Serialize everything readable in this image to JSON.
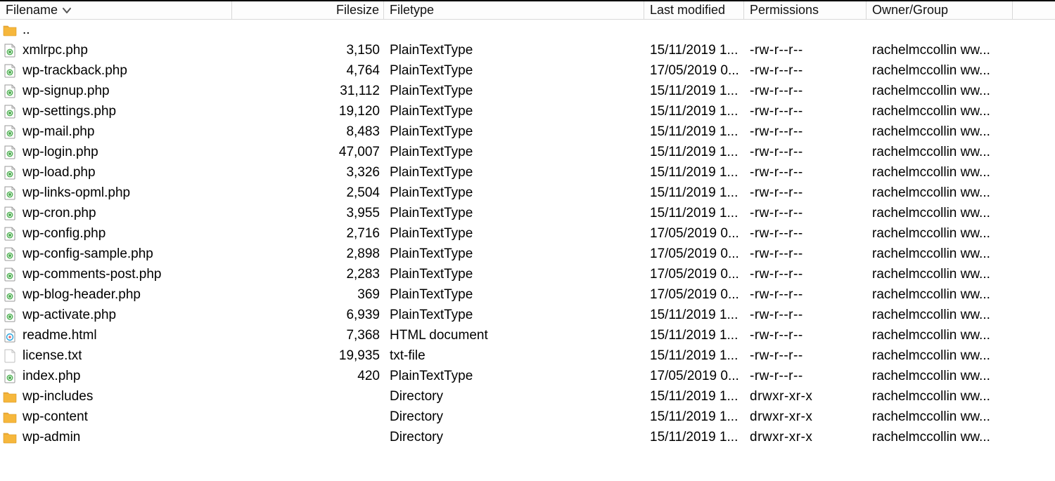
{
  "columns": {
    "filename": "Filename",
    "filesize": "Filesize",
    "filetype": "Filetype",
    "last_modified": "Last modified",
    "permissions": "Permissions",
    "owner_group": "Owner/Group"
  },
  "sort": {
    "column": "filename",
    "direction": "desc"
  },
  "entries": [
    {
      "icon": "folder",
      "name": "..",
      "size": "",
      "type": "",
      "modified": "",
      "perms": "",
      "owner": ""
    },
    {
      "icon": "php",
      "name": "xmlrpc.php",
      "size": "3,150",
      "type": "PlainTextType",
      "modified": "15/11/2019 1...",
      "perms": "-rw-r--r--",
      "owner": "rachelmccollin ww..."
    },
    {
      "icon": "php",
      "name": "wp-trackback.php",
      "size": "4,764",
      "type": "PlainTextType",
      "modified": "17/05/2019 0...",
      "perms": "-rw-r--r--",
      "owner": "rachelmccollin ww..."
    },
    {
      "icon": "php",
      "name": "wp-signup.php",
      "size": "31,112",
      "type": "PlainTextType",
      "modified": "15/11/2019 1...",
      "perms": "-rw-r--r--",
      "owner": "rachelmccollin ww..."
    },
    {
      "icon": "php",
      "name": "wp-settings.php",
      "size": "19,120",
      "type": "PlainTextType",
      "modified": "15/11/2019 1...",
      "perms": "-rw-r--r--",
      "owner": "rachelmccollin ww..."
    },
    {
      "icon": "php",
      "name": "wp-mail.php",
      "size": "8,483",
      "type": "PlainTextType",
      "modified": "15/11/2019 1...",
      "perms": "-rw-r--r--",
      "owner": "rachelmccollin ww..."
    },
    {
      "icon": "php",
      "name": "wp-login.php",
      "size": "47,007",
      "type": "PlainTextType",
      "modified": "15/11/2019 1...",
      "perms": "-rw-r--r--",
      "owner": "rachelmccollin ww..."
    },
    {
      "icon": "php",
      "name": "wp-load.php",
      "size": "3,326",
      "type": "PlainTextType",
      "modified": "15/11/2019 1...",
      "perms": "-rw-r--r--",
      "owner": "rachelmccollin ww..."
    },
    {
      "icon": "php",
      "name": "wp-links-opml.php",
      "size": "2,504",
      "type": "PlainTextType",
      "modified": "15/11/2019 1...",
      "perms": "-rw-r--r--",
      "owner": "rachelmccollin ww..."
    },
    {
      "icon": "php",
      "name": "wp-cron.php",
      "size": "3,955",
      "type": "PlainTextType",
      "modified": "15/11/2019 1...",
      "perms": "-rw-r--r--",
      "owner": "rachelmccollin ww..."
    },
    {
      "icon": "php",
      "name": "wp-config.php",
      "size": "2,716",
      "type": "PlainTextType",
      "modified": "17/05/2019 0...",
      "perms": "-rw-r--r--",
      "owner": "rachelmccollin ww..."
    },
    {
      "icon": "php",
      "name": "wp-config-sample.php",
      "size": "2,898",
      "type": "PlainTextType",
      "modified": "17/05/2019 0...",
      "perms": "-rw-r--r--",
      "owner": "rachelmccollin ww..."
    },
    {
      "icon": "php",
      "name": "wp-comments-post.php",
      "size": "2,283",
      "type": "PlainTextType",
      "modified": "17/05/2019 0...",
      "perms": "-rw-r--r--",
      "owner": "rachelmccollin ww..."
    },
    {
      "icon": "php",
      "name": "wp-blog-header.php",
      "size": "369",
      "type": "PlainTextType",
      "modified": "17/05/2019 0...",
      "perms": "-rw-r--r--",
      "owner": "rachelmccollin ww..."
    },
    {
      "icon": "php",
      "name": "wp-activate.php",
      "size": "6,939",
      "type": "PlainTextType",
      "modified": "15/11/2019 1...",
      "perms": "-rw-r--r--",
      "owner": "rachelmccollin ww..."
    },
    {
      "icon": "html",
      "name": "readme.html",
      "size": "7,368",
      "type": "HTML document",
      "modified": "15/11/2019 1...",
      "perms": "-rw-r--r--",
      "owner": "rachelmccollin ww..."
    },
    {
      "icon": "txt",
      "name": "license.txt",
      "size": "19,935",
      "type": "txt-file",
      "modified": "15/11/2019 1...",
      "perms": "-rw-r--r--",
      "owner": "rachelmccollin ww..."
    },
    {
      "icon": "php",
      "name": "index.php",
      "size": "420",
      "type": "PlainTextType",
      "modified": "17/05/2019 0...",
      "perms": "-rw-r--r--",
      "owner": "rachelmccollin ww..."
    },
    {
      "icon": "folder",
      "name": "wp-includes",
      "size": "",
      "type": "Directory",
      "modified": "15/11/2019 1...",
      "perms": "drwxr-xr-x",
      "owner": "rachelmccollin ww..."
    },
    {
      "icon": "folder",
      "name": "wp-content",
      "size": "",
      "type": "Directory",
      "modified": "15/11/2019 1...",
      "perms": "drwxr-xr-x",
      "owner": "rachelmccollin ww..."
    },
    {
      "icon": "folder",
      "name": "wp-admin",
      "size": "",
      "type": "Directory",
      "modified": "15/11/2019 1...",
      "perms": "drwxr-xr-x",
      "owner": "rachelmccollin ww..."
    }
  ]
}
